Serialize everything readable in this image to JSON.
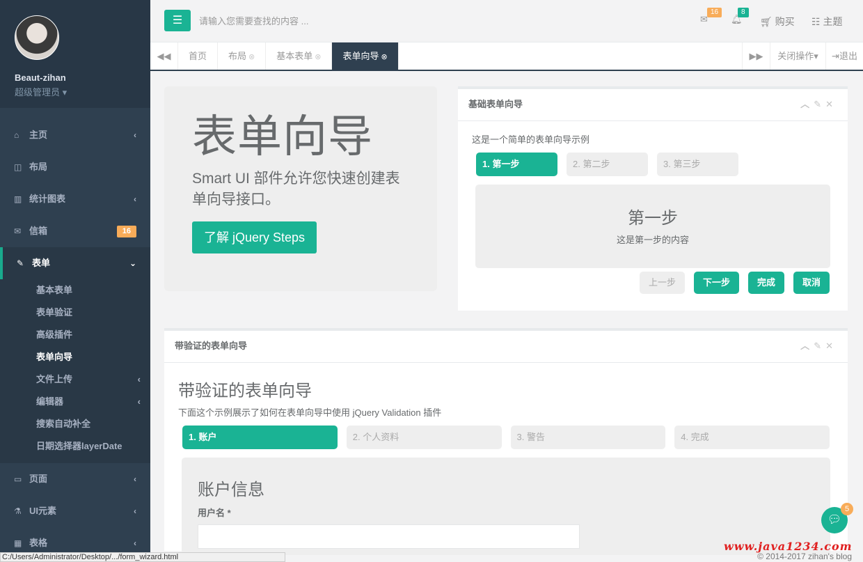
{
  "user": {
    "name": "Beaut-zihan",
    "role": "超级管理员"
  },
  "sidebar": {
    "items": [
      {
        "label": "主页",
        "icon": "home-icon",
        "glyph": "⌂",
        "arrow": "‹"
      },
      {
        "label": "布局",
        "icon": "columns-icon",
        "glyph": "◫",
        "arrow": ""
      },
      {
        "label": "统计图表",
        "icon": "bar-chart-icon",
        "glyph": "▥",
        "arrow": "‹"
      },
      {
        "label": "信箱",
        "icon": "envelope-icon",
        "glyph": "✉",
        "badge": "16"
      },
      {
        "label": "表单",
        "icon": "edit-icon",
        "glyph": "✎",
        "arrow": "⌄"
      },
      {
        "label": "页面",
        "icon": "desktop-icon",
        "glyph": "▭",
        "arrow": "‹"
      },
      {
        "label": "UI元素",
        "icon": "flask-icon",
        "glyph": "⚗",
        "arrow": "‹"
      },
      {
        "label": "表格",
        "icon": "table-icon",
        "glyph": "▦",
        "arrow": "‹"
      }
    ],
    "form_sub": [
      "基本表单",
      "表单验证",
      "高级插件",
      "表单向导",
      "文件上传",
      "编辑器",
      "搜索自动补全",
      "日期选择器layerDate"
    ]
  },
  "topbar": {
    "search_placeholder": "请输入您需要查找的内容 ...",
    "mail_count": "16",
    "bell_count": "8",
    "buy": "购买",
    "theme": "主题",
    "colors": {
      "accent": "#1ab394",
      "warning": "#f8ac59"
    }
  },
  "tabs": [
    "首页",
    "布局",
    "基本表单",
    "表单向导"
  ],
  "tab_ops": {
    "close": "关闭操作",
    "logout": "退出"
  },
  "jumbotron": {
    "title": "表单向导",
    "text": "Smart UI 部件允许您快速创建表单向导接口。",
    "button": "了解 jQuery Steps"
  },
  "wizard1": {
    "title": "基础表单向导",
    "desc": "这是一个简单的表单向导示例",
    "steps": [
      "1. 第一步",
      "2. 第二步",
      "3. 第三步"
    ],
    "content_title": "第一步",
    "content_text": "这是第一步的内容",
    "buttons": {
      "prev": "上一步",
      "next": "下一步",
      "finish": "完成",
      "cancel": "取消"
    }
  },
  "wizard2": {
    "title": "带验证的表单向导",
    "heading": "带验证的表单向导",
    "sub": "下面这个示例展示了如何在表单向导中使用 jQuery Validation 插件",
    "steps": [
      "1. 账户",
      "2. 个人资料",
      "3. 警告",
      "4. 完成"
    ],
    "section": "账户信息",
    "username_label": "用户名 *"
  },
  "footer": {
    "copyright": "© 2014-2017 zihan's blog",
    "watermark": "www.java1234.com"
  },
  "statusbar": "C:/Users/Administrator/Desktop/.../form_wizard.html",
  "chat_badge": "5"
}
